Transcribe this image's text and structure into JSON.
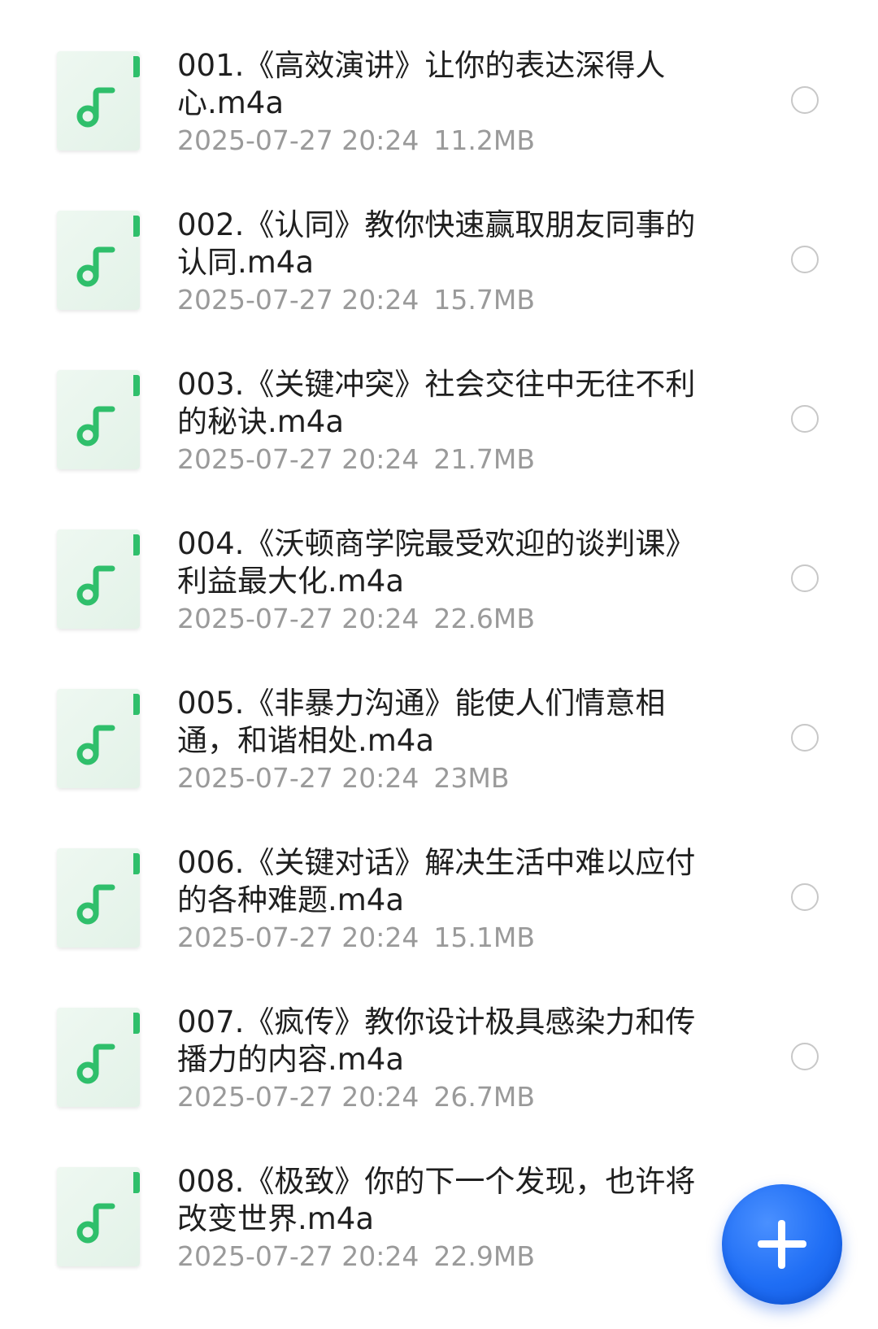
{
  "files": [
    {
      "name": "001.《高效演讲》让你的表达深得人心.m4a",
      "date": "2025-07-27 20:24",
      "size": "11.2MB",
      "icon": "music-note-icon"
    },
    {
      "name": "002.《认同》教你快速赢取朋友同事的认同.m4a",
      "date": "2025-07-27 20:24",
      "size": "15.7MB",
      "icon": "music-note-icon"
    },
    {
      "name": "003.《关键冲突》社会交往中无往不利的秘诀.m4a",
      "date": "2025-07-27 20:24",
      "size": "21.7MB",
      "icon": "music-note-icon"
    },
    {
      "name": "004.《沃顿商学院最受欢迎的谈判课》利益最大化.m4a",
      "date": "2025-07-27 20:24",
      "size": "22.6MB",
      "icon": "music-note-icon"
    },
    {
      "name": "005.《非暴力沟通》能使人们情意相通，和谐相处.m4a",
      "date": "2025-07-27 20:24",
      "size": "23MB",
      "icon": "music-note-icon"
    },
    {
      "name": "006.《关键对话》解决生活中难以应付的各种难题.m4a",
      "date": "2025-07-27 20:24",
      "size": "15.1MB",
      "icon": "music-note-icon"
    },
    {
      "name": "007.《疯传》教你设计极具感染力和传播力的内容.m4a",
      "date": "2025-07-27 20:24",
      "size": "26.7MB",
      "icon": "music-note-icon"
    },
    {
      "name": "008.《极致》你的下一个发现，也许将改变世界.m4a",
      "date": "2025-07-27 20:24",
      "size": "22.9MB",
      "icon": "music-note-icon"
    }
  ],
  "fab": {
    "icon": "plus-icon"
  },
  "colors": {
    "accent_green": "#2fbf6b",
    "fab_blue": "#1f6ef5",
    "title_text": "#1f1f1f",
    "meta_text": "#9a9a9a",
    "radio_border": "#c8c8c8"
  }
}
